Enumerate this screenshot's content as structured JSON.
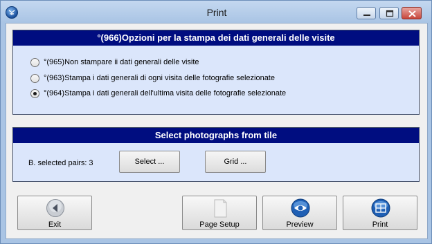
{
  "window": {
    "title": "Print"
  },
  "options_group": {
    "header": "°(966)Opzioni per la stampa dei dati generali delle visite",
    "options": [
      {
        "label": "°(965)Non stampare ii dati generali delle visite",
        "checked": false
      },
      {
        "label": "°(963)Stampa i dati generali di ogni visita delle fotografie selezionate",
        "checked": false
      },
      {
        "label": "°(964)Stampa i dati generali dell'ultima visita delle fotografie selezionate",
        "checked": true
      }
    ]
  },
  "photos_group": {
    "header": "Select photographs from tile",
    "selected_pairs_label": "B. selected pairs: 3",
    "select_button": "Select ...",
    "grid_button": "Grid ..."
  },
  "actions": {
    "exit": "Exit",
    "page_setup": "Page Setup",
    "preview": "Preview",
    "print": "Print"
  },
  "colors": {
    "header_bg": "#000d80",
    "group_bg": "#dbe6fb",
    "window_frame": "#a9c4e4"
  }
}
